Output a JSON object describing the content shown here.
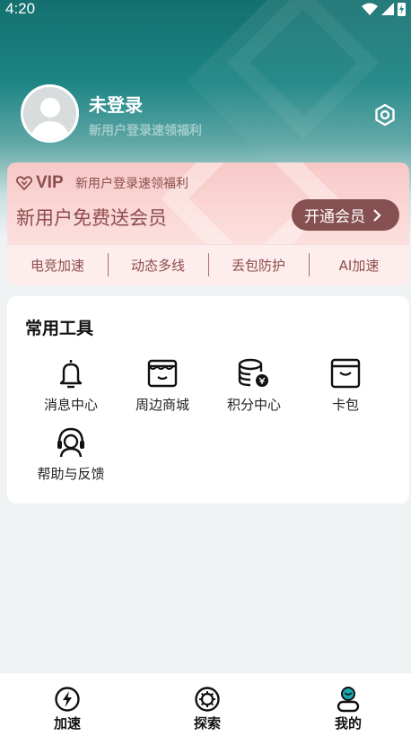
{
  "status_bar": {
    "time": "4:20"
  },
  "profile": {
    "username": "未登录",
    "subtitle": "新用户登录速领福利",
    "settings_icon": "settings-hexagon-icon"
  },
  "vip": {
    "brand": "VIP",
    "tag": "新用户登录速领福利",
    "title": "新用户免费送会员",
    "button_label": "开通会员",
    "features": [
      "电竞加速",
      "动态多线",
      "丢包防护",
      "AI加速"
    ],
    "accent_color": "#8e4d4d",
    "button_color": "#875050"
  },
  "tools": {
    "title": "常用工具",
    "items": [
      {
        "label": "消息中心",
        "icon": "bell-icon"
      },
      {
        "label": "周边商城",
        "icon": "shop-icon"
      },
      {
        "label": "积分中心",
        "icon": "coins-icon"
      },
      {
        "label": "卡包",
        "icon": "wallet-icon"
      },
      {
        "label": "帮助与反馈",
        "icon": "headset-icon"
      }
    ]
  },
  "bottom_nav": {
    "items": [
      {
        "label": "加速",
        "icon": "lightning-icon"
      },
      {
        "label": "探索",
        "icon": "gear-explore-icon"
      },
      {
        "label": "我的",
        "icon": "user-icon",
        "active": true
      }
    ],
    "active_color": "#1aa7b0"
  }
}
